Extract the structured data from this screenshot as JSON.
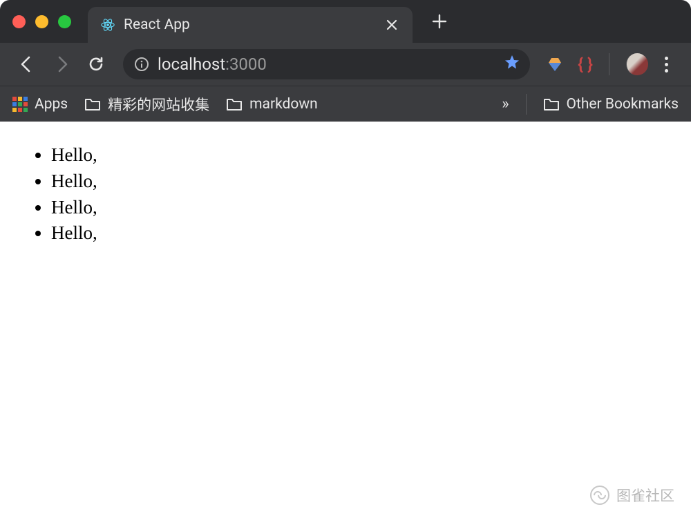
{
  "tab": {
    "title": "React App",
    "favicon": "react-icon"
  },
  "url": {
    "host": "localhost",
    "port": ":3000",
    "bookmarked": true
  },
  "bookmarks": {
    "apps_label": "Apps",
    "folders": [
      {
        "label": "精彩的网站收集"
      },
      {
        "label": "markdown"
      }
    ],
    "overflow": "»",
    "other_label": "Other Bookmarks"
  },
  "extensions": [
    {
      "name": "blue-diamond-extension"
    },
    {
      "name": "braces-extension"
    }
  ],
  "page": {
    "items": [
      "Hello,",
      "Hello,",
      "Hello,",
      "Hello,"
    ]
  },
  "watermark": {
    "text": "图雀社区"
  }
}
